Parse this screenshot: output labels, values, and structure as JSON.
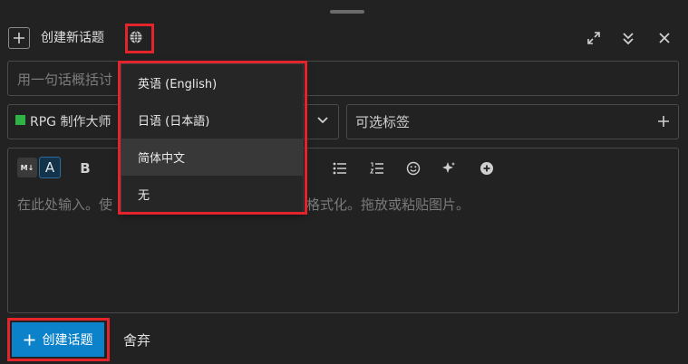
{
  "header": {
    "title": "创建新话题",
    "new_icon": "plus-icon",
    "lang_icon": "globe-icon",
    "actions": [
      "expand-icon",
      "collapse-icon",
      "close-icon"
    ]
  },
  "title_input": {
    "placeholder": "用一句话概括讨"
  },
  "category": {
    "label": "RPG 制作大师",
    "color": "#2fb344"
  },
  "tags": {
    "placeholder": "可选标签"
  },
  "editor": {
    "toolbar": {
      "md_label": "M↓",
      "a_label": "A",
      "bold_label": "B"
    },
    "placeholder": "在此处输入。使",
    "placeholder_tail": "格式化。拖放或粘贴图片。"
  },
  "language_menu": {
    "items": [
      {
        "label": "英语 (English)"
      },
      {
        "label": "日语 (日本語)"
      },
      {
        "label": "简体中文",
        "selected": true
      },
      {
        "label": "无"
      }
    ]
  },
  "footer": {
    "create_label": "创建话题",
    "discard_label": "舍弃",
    "accent": "#0b82c9"
  }
}
